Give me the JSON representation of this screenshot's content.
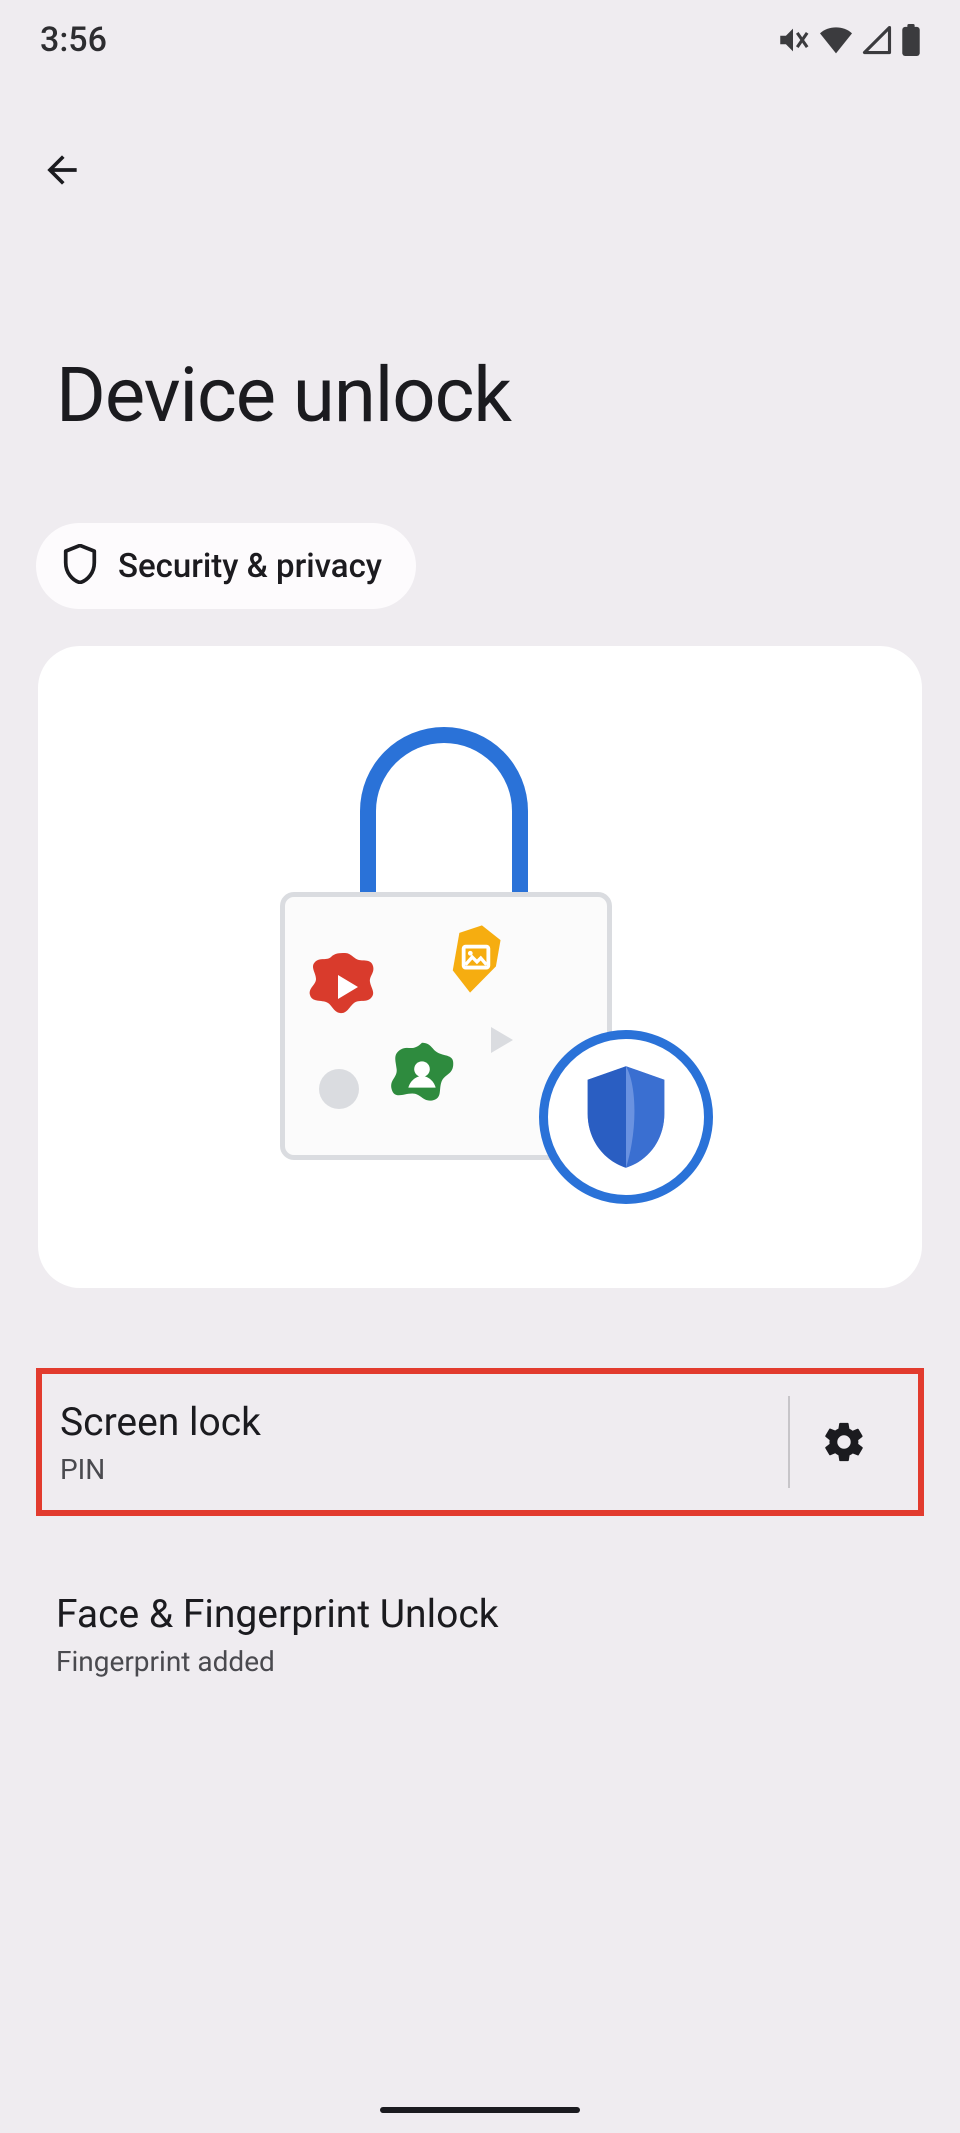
{
  "status": {
    "time": "3:56"
  },
  "header": {
    "title": "Device unlock"
  },
  "chip": {
    "label": "Security & privacy"
  },
  "items": {
    "screenlock": {
      "title": "Screen lock",
      "sub": "PIN"
    },
    "biometric": {
      "title": "Face & Fingerprint Unlock",
      "sub": "Fingerprint added"
    }
  }
}
